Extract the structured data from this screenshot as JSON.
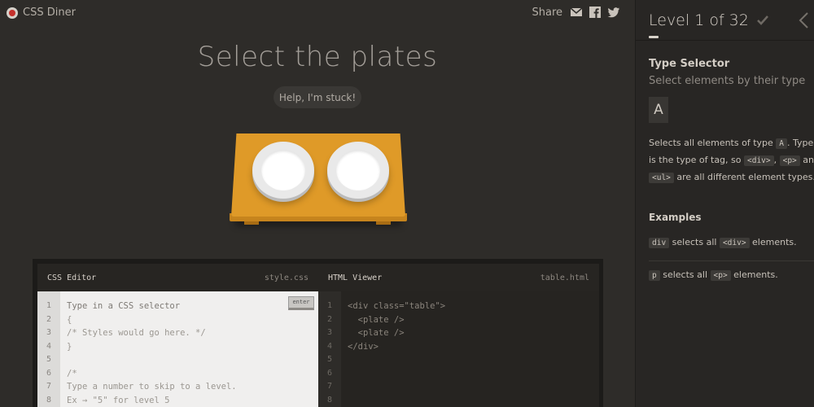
{
  "app": {
    "name": "CSS Diner"
  },
  "share": {
    "label": "Share",
    "icons": [
      "mail-icon",
      "facebook-icon",
      "twitter-icon"
    ]
  },
  "instruction": "Select the plates",
  "help_button": "Help, I'm stuck!",
  "scene": {
    "plates": 2
  },
  "css_editor": {
    "title": "CSS Editor",
    "file": "style.css",
    "enter_label": "enter",
    "line_numbers": [
      "1",
      "2",
      "3",
      "4",
      "5",
      "6",
      "7",
      "8"
    ],
    "placeholder_line": "Type in a CSS selector",
    "lines": "{\n/* Styles would go here. */\n}\n\n/*\nType a number to skip to a level.\nEx → \"5\" for level 5"
  },
  "html_viewer": {
    "title": "HTML Viewer",
    "file": "table.html",
    "line_numbers": [
      "1",
      "2",
      "3",
      "4",
      "5",
      "6",
      "7",
      "8"
    ],
    "lines": "<div class=\"table\">\n  <plate />\n  <plate />\n</div>"
  },
  "sidebar": {
    "level_label": "Level 1 of 32",
    "progress": 0.03,
    "selector_name": "Type Selector",
    "selector_description": "Select elements by their type",
    "syntax": "A",
    "hint": {
      "p1": "Selects all elements of type ",
      "t1": "A",
      "p2": ". Type is the type of tag, so ",
      "t2": "<div>",
      "p3": ", ",
      "t3": "<p>",
      "p4": " and ",
      "t4": "<ul>",
      "p5": " are all different element types."
    },
    "examples_title": "Examples",
    "examples": [
      {
        "tag1": "div",
        "text1": " selects all ",
        "tag2": "<div>",
        "text2": " elements."
      },
      {
        "tag1": "p",
        "text1": " selects all ",
        "tag2": "<p>",
        "text2": " elements."
      }
    ]
  },
  "colors": {
    "background": "#2e2c29",
    "table": "#df9a28",
    "sidebar": "#282624",
    "logo_red": "#c4302b"
  }
}
